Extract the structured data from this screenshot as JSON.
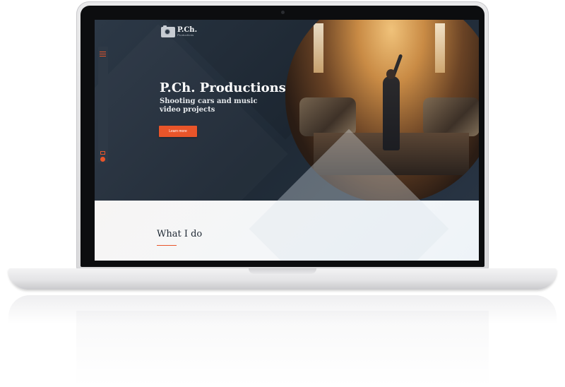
{
  "site": {
    "logo": {
      "title": "P.Ch.",
      "subtitle": "Productions",
      "icon": "camera-icon"
    },
    "sidebar": {
      "icons": [
        "hamburger-icon",
        "mail-icon",
        "github-icon"
      ]
    },
    "hero": {
      "title": "P.Ch. Productions",
      "subtitle": "Shooting cars and music video projects",
      "button_label": "Learn more"
    },
    "section": {
      "title": "What I do"
    }
  },
  "colors": {
    "accent": "#e8552a",
    "hero_background": "#243040",
    "section_background": "#f4f6f9"
  }
}
